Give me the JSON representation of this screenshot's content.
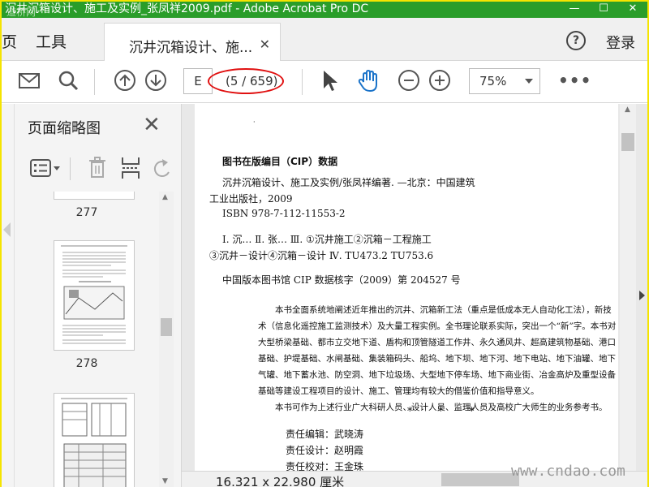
{
  "window": {
    "title": "沉井沉箱设计、施工及实例_张凤祥2009.pdf - Adobe Acrobat Pro DC",
    "watermark_top": "道桥网",
    "controls": [
      "—",
      "☐",
      "✕"
    ]
  },
  "tabs": {
    "home": "页",
    "tools": "工具",
    "document": "沉井沉箱设计、施...",
    "close": "✕",
    "help": "?",
    "login": "登录"
  },
  "toolbar": {
    "page_input": "E",
    "page_count": "(5 / 659)",
    "zoom": "75%",
    "more": "•••"
  },
  "left_pane": {
    "title": "页面缩略图",
    "close": "✕",
    "thumbnails": [
      "277",
      "278"
    ]
  },
  "document": {
    "cip_title": "图书在版编目（CIP）数据",
    "cip_line1": "沉井沉箱设计、施工及实例/张凤祥编著.  —北京：中国建筑",
    "cip_line2": "工业出版社，2009",
    "isbn": "ISBN 978-7-112-11553-2",
    "class_line1": "Ⅰ. 沉…  Ⅱ. 张…  Ⅲ. ①沉井施工②沉箱－工程施工",
    "class_line2": "③沉井－设计④沉箱－设计  Ⅳ. TU473.2  TU753.6",
    "cip_number": "中国版本图书馆 CIP 数据核字（2009）第 204527 号",
    "para1": "本书全面系统地阐述近年推出的沉井、沉箱新工法（重点是低成本无人自动化工法），新技术（信息化遥控施工监测技术）及大量工程实例。全书理论联系实际，突出一个“新”字。本书对大型桥梁基础、都市立交地下道、盾构和顶管隧道工作井、永久通风井、超高建筑物基础、港口基础、护堤基础、水闸基础、集装箱码头、船坞、地下坝、地下河、地下电站、地下油罐、地下气罐、地下蓄水池、防空洞、地下垃圾场、大型地下停车场、地下商业街、冶金高炉及重型设备基础等建设工程项目的设计、施工、管理均有较大的借鉴价值和指导意义。",
    "para2": "本书可作为上述行业广大科研人员、设计人员、监理人员及高校广大师生的业务参考书。",
    "stars": [
      "*",
      "*",
      "*"
    ],
    "editor": "责任编辑：武晓涛",
    "designer": "责任设计：赵明霞",
    "proofreader": "责任校对：王金珠"
  },
  "status": {
    "dimensions": "16.321 x 22.980 厘米"
  },
  "watermark_bottom": "www.cndao.com"
}
